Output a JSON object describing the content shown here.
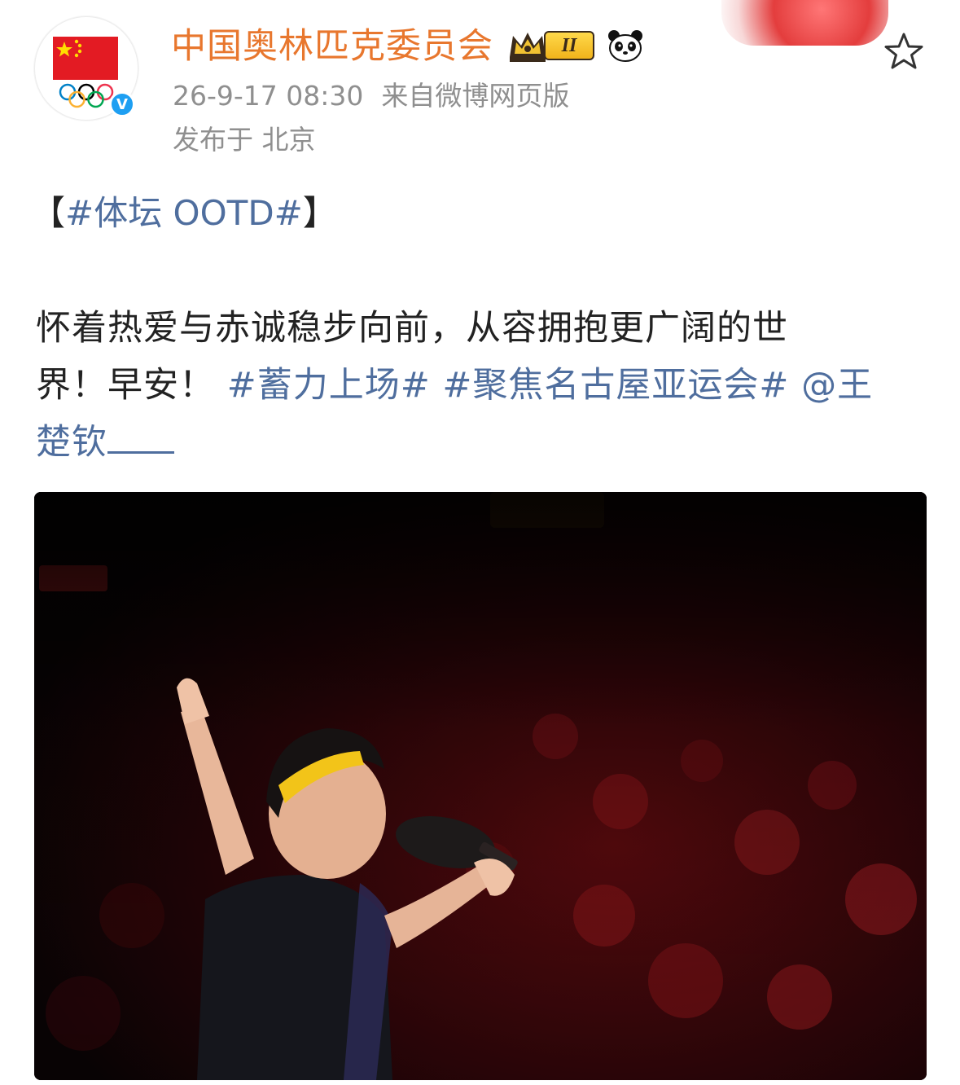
{
  "account": {
    "name": "中国奥林匹克委员会",
    "level_badge": "II",
    "verified_icon": "V"
  },
  "post": {
    "date": "26-9-17 08:30",
    "source": "来自微博网页版",
    "location": "发布于 北京",
    "bracket_open": "【",
    "topic_main": "#体坛 OOTD#",
    "bracket_close": "】",
    "line1": "怀着热爱与赤诚稳步向前，从容拥抱更广阔的世",
    "line2_text": "界！早安！",
    "topic1": "#蓄力上场#",
    "topic2": "#聚焦名古屋亚运会#",
    "mention_part1": "@王",
    "mention_part2": "楚钦"
  },
  "icons": {
    "avatar": "china-olympic-flag-avatar",
    "verified": "verified-badge-icon",
    "crown": "crown-icon",
    "panda": "panda-icon",
    "favorite": "star-outline-icon"
  },
  "colors": {
    "username": "#e8772e",
    "link": "#4f6e9e",
    "meta": "#8f8f8f",
    "text": "#222222",
    "verified": "#1e9ff2"
  }
}
